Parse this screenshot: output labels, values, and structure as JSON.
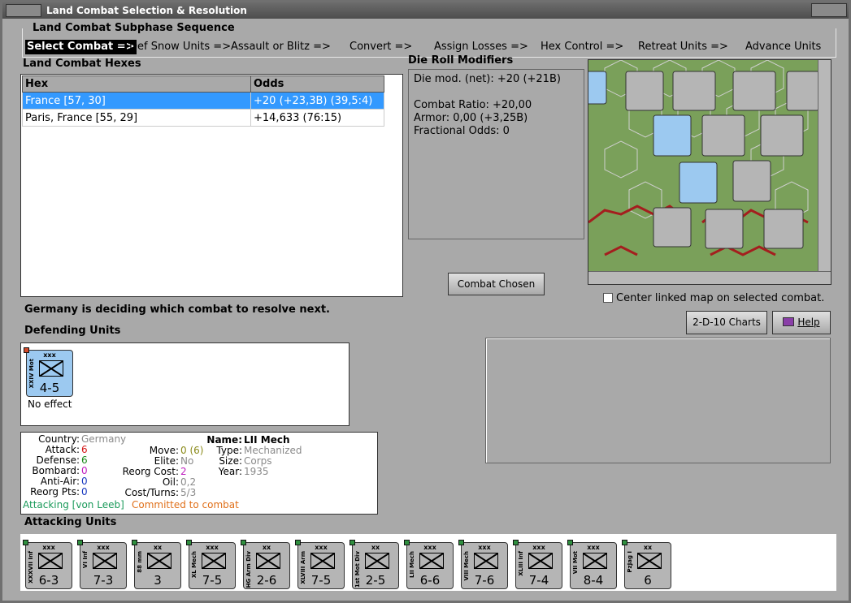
{
  "window": {
    "title": "Land Combat Selection & Resolution"
  },
  "subphase": {
    "title": "Land Combat Subphase Sequence",
    "steps": [
      "Select Combat =>",
      "Def Snow Units =>",
      "Assault or Blitz =>",
      "Convert =>",
      "Assign Losses =>",
      "Hex Control =>",
      "Retreat Units =>",
      "Advance Units"
    ]
  },
  "hexes": {
    "title": "Land Combat Hexes",
    "headers": [
      "Hex",
      "Odds"
    ],
    "rows": [
      {
        "hex": "France [57, 30]",
        "odds": "+20 (+23,3B) (39,5:4)"
      },
      {
        "hex": "Paris, France [55, 29]",
        "odds": "+14,633 (76:15)"
      }
    ]
  },
  "drm": {
    "title": "Die Roll Modifiers",
    "net": "Die mod. (net): +20 (+21B)",
    "ratio": "Combat Ratio: +20,00",
    "armor": "Armor: 0,00 (+3,25B)",
    "frac": "Fractional Odds: 0"
  },
  "buttons": {
    "combat_chosen": "Combat Chosen",
    "charts": "2-D-10 Charts",
    "help": "Help"
  },
  "center_map_label": "Center linked map on selected combat.",
  "status": "Germany is deciding which combat to resolve next.",
  "defending": {
    "title": "Defending Units",
    "unit": {
      "size": "xxx",
      "name": "XXIV Mot",
      "strength": "4-5",
      "result": "No effect"
    }
  },
  "info": {
    "country_lbl": "Country:",
    "country": "Germany",
    "attack_lbl": "Attack:",
    "attack": "6",
    "defense_lbl": "Defense:",
    "defense": "6",
    "bombard_lbl": "Bombard:",
    "bombard": "0",
    "antiair_lbl": "Anti-Air:",
    "antiair": "0",
    "reorgpts_lbl": "Reorg Pts:",
    "reorgpts": "0",
    "move_lbl": "Move:",
    "move": "0 (6)",
    "elite_lbl": "Elite:",
    "elite": "No",
    "reorgcost_lbl": "Reorg Cost:",
    "reorgcost": "2",
    "oil_lbl": "Oil:",
    "oil": "0,2",
    "costturns_lbl": "Cost/Turns:",
    "costturns": "5/3",
    "name_lbl": "Name:",
    "name": "LII Mech",
    "type_lbl": "Type:",
    "type": "Mechanized",
    "size_lbl": "Size:",
    "size": "Corps",
    "year_lbl": "Year:",
    "year": "1935",
    "attacking": "Attacking [von Leeb]",
    "committed": "Committed to combat"
  },
  "attacking": {
    "title": "Attacking Units",
    "units": [
      {
        "size": "xxx",
        "name": "XXXVII Inf",
        "strength": "6-3"
      },
      {
        "size": "xxx",
        "name": "VI Inf",
        "strength": "7-3"
      },
      {
        "size": "xx",
        "name": "88 mm",
        "strength": "3"
      },
      {
        "size": "xxx",
        "name": "XL Mech",
        "strength": "7-5"
      },
      {
        "size": "xx",
        "name": "HG Arm Div",
        "strength": "2-6"
      },
      {
        "size": "xxx",
        "name": "XLVIII Arm",
        "strength": "7-5"
      },
      {
        "size": "xx",
        "name": "1st Mot Div",
        "strength": "2-5"
      },
      {
        "size": "xxx",
        "name": "LII Mech",
        "strength": "6-6"
      },
      {
        "size": "xxx",
        "name": "VIII Mech",
        "strength": "7-6"
      },
      {
        "size": "xxx",
        "name": "XLIII Inf",
        "strength": "7-4"
      },
      {
        "size": "xxx",
        "name": "VII Mot",
        "strength": "8-4"
      },
      {
        "size": "xx",
        "name": "PzJag I",
        "strength": "6"
      }
    ]
  }
}
